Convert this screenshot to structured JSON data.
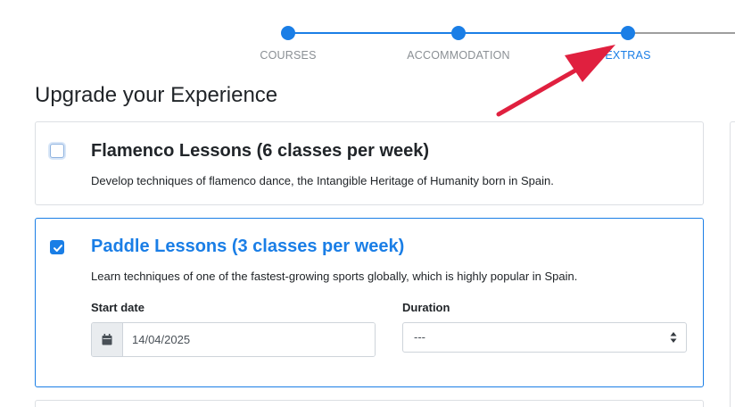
{
  "stepper": {
    "steps": [
      {
        "label": "COURSES",
        "state": "done"
      },
      {
        "label": "ACCOMMODATION",
        "state": "done"
      },
      {
        "label": "EXTRAS",
        "state": "active"
      }
    ]
  },
  "page": {
    "title": "Upgrade your Experience"
  },
  "extras": [
    {
      "title": "Flamenco Lessons (6 classes per week)",
      "description": "Develop techniques of flamenco dance, the Intangible Heritage of Humanity born in Spain.",
      "checked": false
    },
    {
      "title": "Paddle Lessons (3 classes per week)",
      "description": "Learn techniques of one of the fastest-growing sports globally, which is highly popular in Spain.",
      "checked": true,
      "start_date_label": "Start date",
      "start_date_value": "14/04/2025",
      "duration_label": "Duration",
      "duration_value": "---"
    }
  ],
  "icons": {
    "calendar": "calendar-icon",
    "checkmark": "check-icon",
    "sort_caret": "sort-caret-icon",
    "annotation_arrow": "arrow-icon"
  },
  "colors": {
    "accent": "#1a7ee6",
    "annotation": "#e0203f",
    "muted_step": "#8a8f94"
  }
}
